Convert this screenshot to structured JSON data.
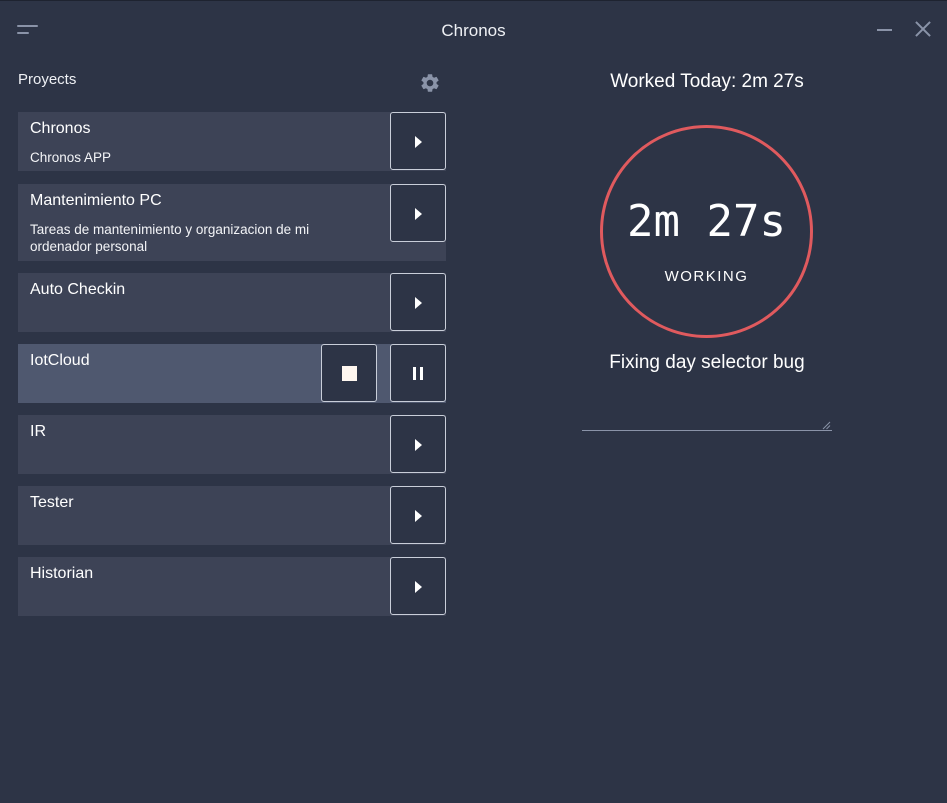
{
  "window": {
    "title": "Chronos"
  },
  "sidebar": {
    "header": "Proyects",
    "projects": [
      {
        "name": "Chronos",
        "description": "Chronos APP",
        "state": "idle"
      },
      {
        "name": "Mantenimiento PC",
        "description": "Tareas de mantenimiento y organizacion de mi ordenador personal",
        "state": "idle"
      },
      {
        "name": "Auto Checkin",
        "description": "",
        "state": "idle"
      },
      {
        "name": "IotCloud",
        "description": "",
        "state": "running"
      },
      {
        "name": "IR",
        "description": "",
        "state": "idle"
      },
      {
        "name": "Tester",
        "description": "",
        "state": "idle"
      },
      {
        "name": "Historian",
        "description": "",
        "state": "idle"
      }
    ]
  },
  "timer": {
    "worked_today": "Worked Today: 2m 27s",
    "value": "2m 27s",
    "status": "WORKING",
    "task_title": "Fixing day selector bug",
    "notes": ""
  },
  "colors": {
    "background": "#2d3446",
    "card": "#3d4356",
    "card_active": "#4f586f",
    "ring": "#e05a5e"
  },
  "icons": {
    "menu": "hamburger-menu-icon",
    "minimize": "minimize-icon",
    "close": "close-icon",
    "settings": "gear-icon",
    "play": "play-icon",
    "stop": "stop-icon",
    "pause": "pause-icon"
  }
}
